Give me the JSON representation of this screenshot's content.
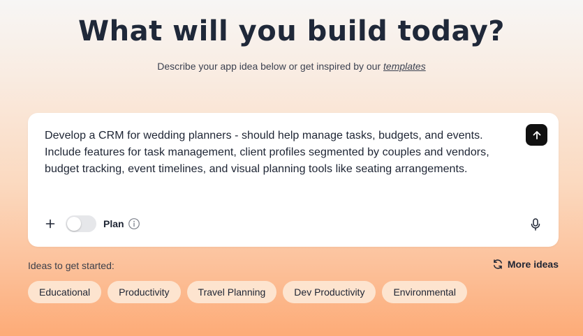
{
  "header": {
    "title": "What will you build today?",
    "subtitle_prefix": "Describe your app idea below or get inspired by our ",
    "subtitle_link": "templates"
  },
  "prompt": {
    "text": "Develop a CRM for wedding planners - should help manage tasks, budgets, and events. Include features for task management, client profiles segmented by couples and vendors, budget tracking, event timelines, and visual planning tools like seating arrangements."
  },
  "toolbar": {
    "plan_label": "Plan",
    "plan_enabled": false,
    "icons": [
      "plus-icon",
      "info-icon",
      "microphone-icon",
      "arrow-up-icon"
    ]
  },
  "ideas": {
    "label": "Ideas to get started:",
    "more_label": "More ideas",
    "chips": [
      "Educational",
      "Productivity",
      "Travel Planning",
      "Dev Productivity",
      "Environmental"
    ]
  },
  "colors": {
    "send_button": "#111111",
    "chip_background": "#fde4cf",
    "gradient_bottom": "#fdab77"
  }
}
